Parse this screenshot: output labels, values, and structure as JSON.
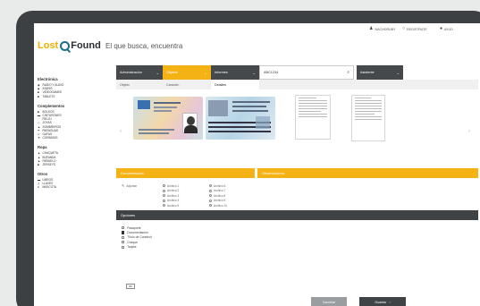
{
  "topbar": {
    "user": "NACHORUBY",
    "register": "REGISTRATE",
    "help": "AYUD"
  },
  "brand": {
    "lost": "Lost",
    "found": "Found",
    "tagline": "El que busca, encuentra"
  },
  "sidebar": {
    "groups": [
      {
        "title": "Electrónica",
        "items": [
          "RADIO Y AUDIO",
          "ATARIS",
          "VIDEOGAMES",
          "TABLETS"
        ]
      },
      {
        "title": "Complementos",
        "items": [
          "BOLSOS",
          "CINTURONES",
          "RELOJ",
          "JOYAS",
          "SOMBREROS",
          "PARAGUAS",
          "GAFAS",
          "CORBATAS"
        ]
      },
      {
        "title": "Ropa",
        "items": [
          "CHAQUETA",
          "BUFANDA",
          "PAÑUELO",
          "JERSEYS"
        ]
      },
      {
        "title": "Otros",
        "items": [
          "LIBROS",
          "LLAVES",
          "MASCOTA"
        ]
      }
    ]
  },
  "toolbar": {
    "admin": "Administración",
    "objetos": "Objetos",
    "informes": "Informes",
    "search_value": "ABC1234",
    "user": "Asistente"
  },
  "subtabs": [
    "Objeto",
    "Caracter.",
    "Detalles"
  ],
  "sections": {
    "documentacion": "Documentación",
    "observaciones": "Observaciones",
    "doc_label": "Adjuntar",
    "col1": [
      "Archivo 1",
      "Archivo 2",
      "Archivo 3",
      "Archivo 4",
      "Archivo 5"
    ],
    "col2": [
      "Archivo 6",
      "Archivo 7",
      "Archivo 8",
      "Archivo 9",
      "Archivo 10"
    ],
    "opciones": "Opciones"
  },
  "options": [
    {
      "label": "Pasaporte",
      "checked": false
    },
    {
      "label": "Documentación",
      "checked": true
    },
    {
      "label": "Título de Conducir",
      "checked": false
    },
    {
      "label": "Cheque",
      "checked": false
    },
    {
      "label": "Tarjeta",
      "checked": false
    }
  ],
  "buttons": {
    "ok": "OK",
    "cancel": "Cancelar",
    "save": "Guardar"
  },
  "colors": {
    "accent": "#f4b215",
    "dark": "#3f4346",
    "brand_blue": "#1f6e88",
    "toolbar_dark": "#45494c"
  }
}
